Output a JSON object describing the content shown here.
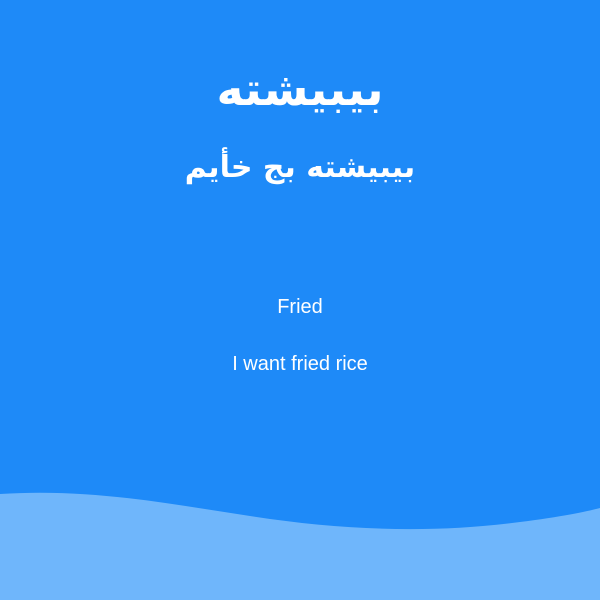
{
  "page": {
    "title": "بيبيشته",
    "subtitle": "بيبيشته بج خأيم",
    "line1": "Fried",
    "line2": "I want fried rice"
  },
  "colors": {
    "background": "#1e8af8",
    "wave": "#6fb6fb",
    "text": "#ffffff"
  }
}
